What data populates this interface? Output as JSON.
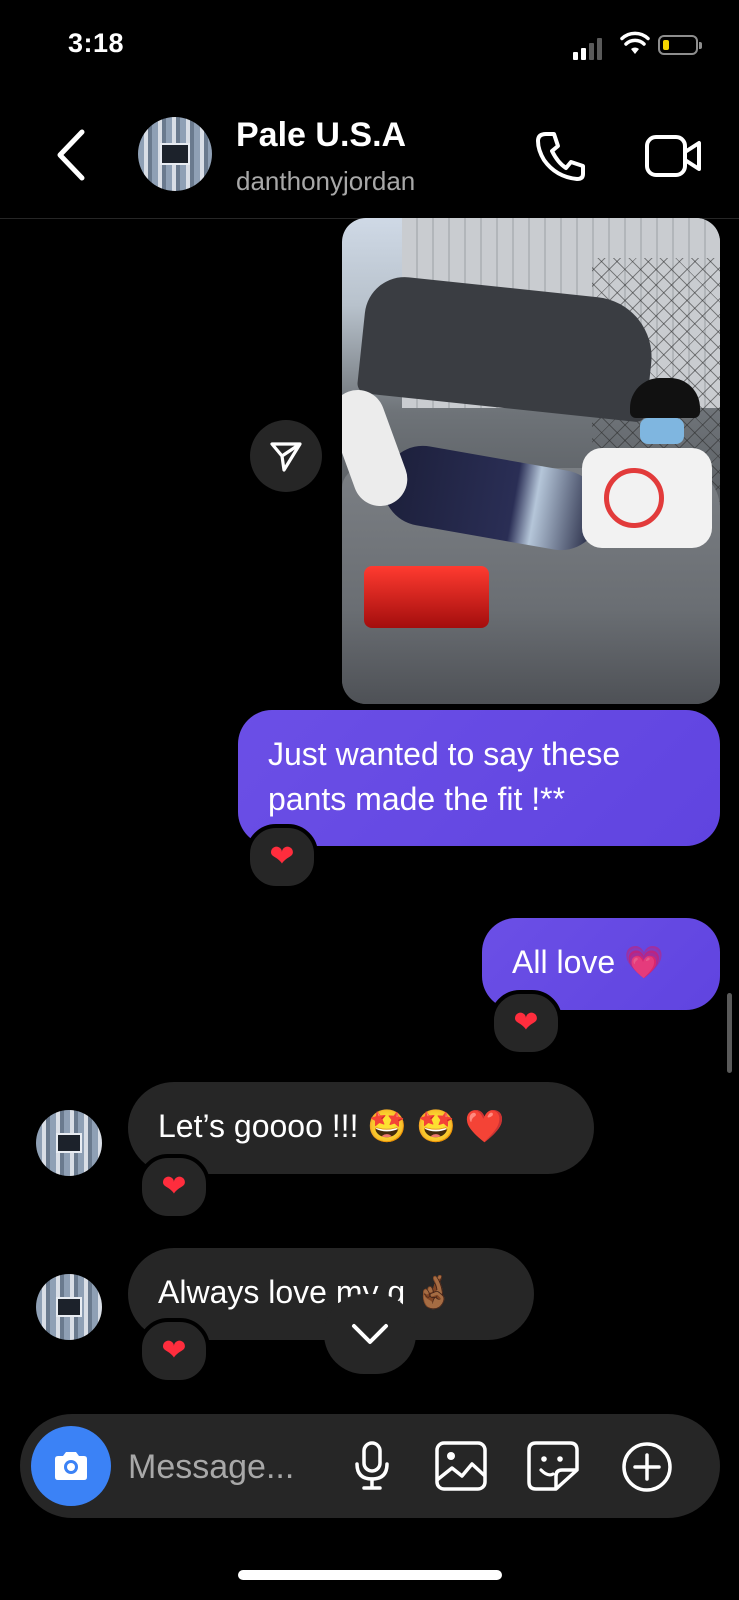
{
  "status_bar": {
    "time": "3:18"
  },
  "header": {
    "name": "Pale U.S.A",
    "username": "danthonyjordan"
  },
  "messages": [
    {
      "type": "image",
      "direction": "outgoing"
    },
    {
      "type": "text",
      "direction": "outgoing",
      "text": "Just wanted to say these pants made the fit !**",
      "reaction": "❤️"
    },
    {
      "type": "text",
      "direction": "outgoing",
      "text": "All love 💗",
      "reaction": "❤️"
    },
    {
      "type": "text",
      "direction": "incoming",
      "text": "Let’s goooo !!! 🤩 🤩 ❤️",
      "reaction": "❤️"
    },
    {
      "type": "text",
      "direction": "incoming",
      "text": "Always love my g 🤞🏾",
      "reaction": "❤️"
    }
  ],
  "composer": {
    "placeholder": "Message..."
  },
  "colors": {
    "background": "#000000",
    "outgoing_bubble": "#6344e0",
    "incoming_bubble": "#262626",
    "camera_button": "#3b82f6",
    "heart": "#ff2d3d"
  },
  "icons": [
    "back-chevron-icon",
    "phone-icon",
    "video-icon",
    "share-icon",
    "chevron-down-icon",
    "camera-icon",
    "microphone-icon",
    "gallery-icon",
    "sticker-icon",
    "plus-icon"
  ]
}
